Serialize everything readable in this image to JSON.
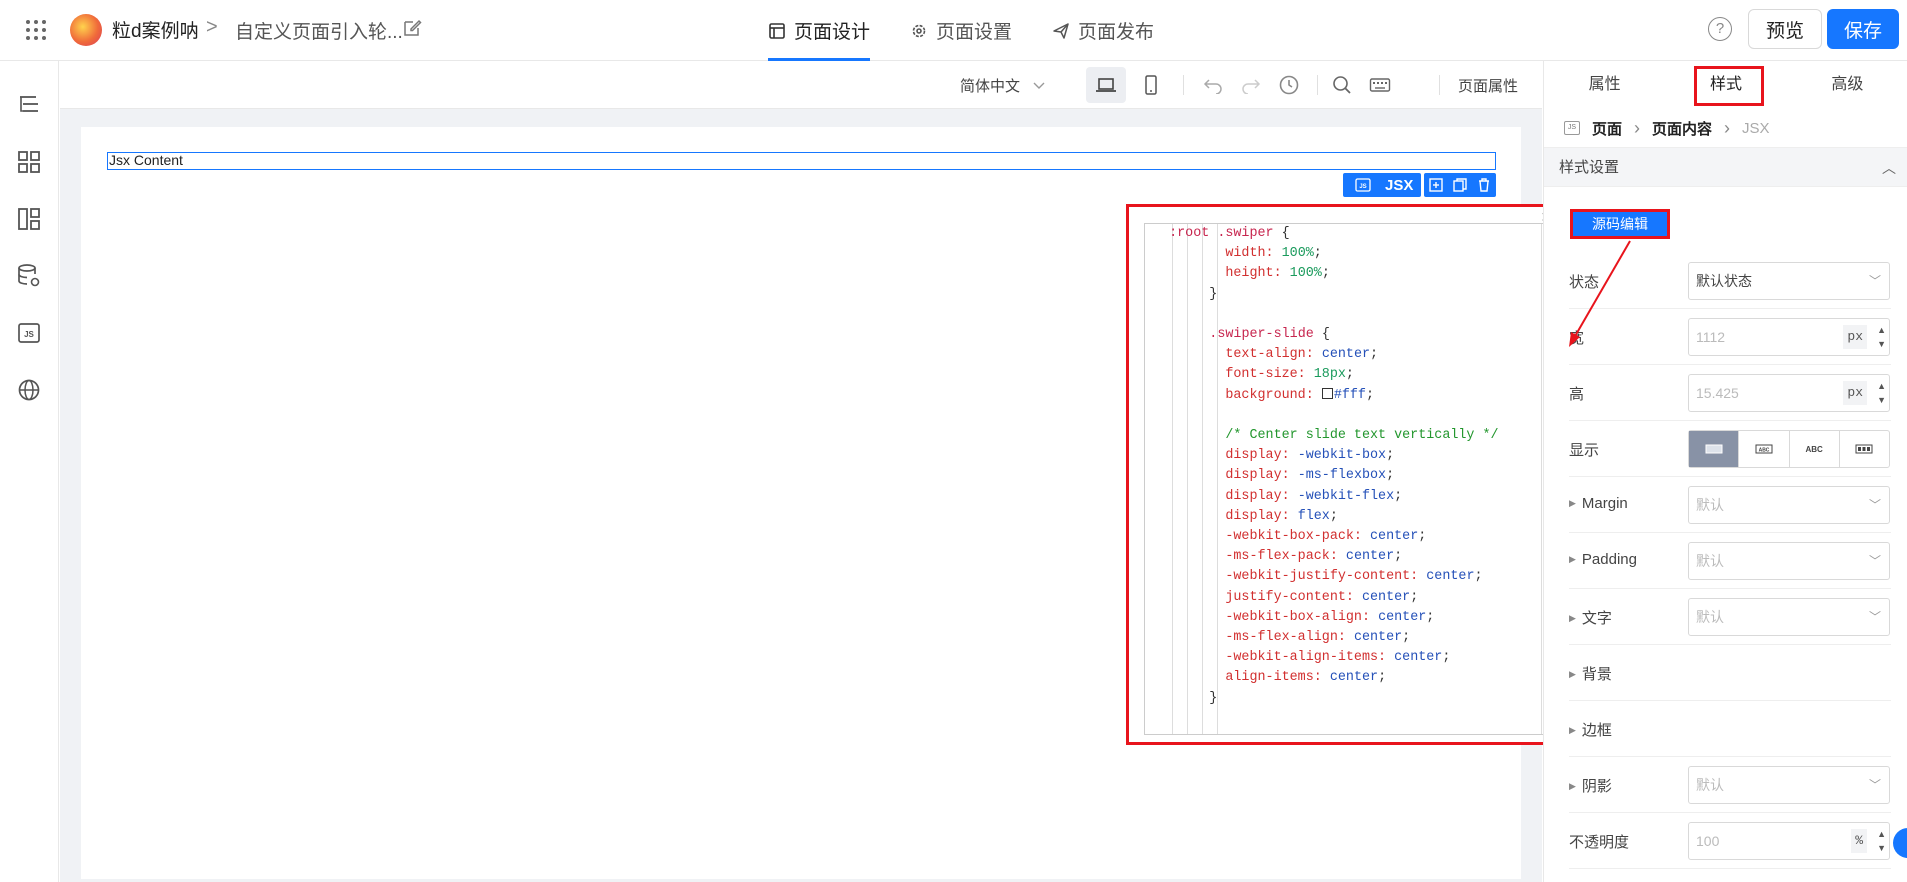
{
  "header": {
    "app_name": "粒d案例呐",
    "breadcrumb_sep": ">",
    "page_name": "自定义页面引入轮...",
    "tabs": [
      {
        "label": "页面设计",
        "icon": "page-design-icon",
        "active": true
      },
      {
        "label": "页面设置",
        "icon": "gear-icon",
        "active": false
      },
      {
        "label": "页面发布",
        "icon": "send-icon",
        "active": false
      }
    ],
    "help_label": "?",
    "preview_label": "预览",
    "save_label": "保存",
    "accent_color": "#1677ff"
  },
  "sidebar": {
    "items": [
      {
        "icon": "outline-tree-icon"
      },
      {
        "icon": "components-grid-icon"
      },
      {
        "icon": "layout-icon"
      },
      {
        "icon": "data-source-icon"
      },
      {
        "icon": "js-code-icon"
      },
      {
        "icon": "globe-icon"
      }
    ]
  },
  "toolbar": {
    "language": "简体中文",
    "page_props": "页面属性",
    "device_active": "desktop"
  },
  "canvas": {
    "component_text": "Jsx Content",
    "component_badge": "JSX",
    "js_badge": "JS"
  },
  "code_editor": {
    "close_label": "×",
    "highlight_color": "#e8141c"
  },
  "right_panel": {
    "tabs": [
      {
        "label": "属性",
        "active": false
      },
      {
        "label": "样式",
        "active": true
      },
      {
        "label": "高级",
        "active": false
      }
    ],
    "breadcrumb": {
      "icon_text": "JS",
      "page": "页面",
      "content": "页面内容",
      "current": "JSX"
    },
    "section_title": "样式设置",
    "source_edit_label": "源码编辑",
    "state": {
      "label": "状态",
      "value": "默认状态"
    },
    "width": {
      "label": "宽",
      "value": "1112",
      "unit": "px"
    },
    "height": {
      "label": "高",
      "value": "15.425",
      "unit": "px"
    },
    "display": {
      "label": "显示",
      "options": [
        "block",
        "ABC",
        "ABC",
        "inline-block"
      ],
      "active_index": 0
    },
    "margin": {
      "label": "Margin",
      "value": "默认"
    },
    "padding": {
      "label": "Padding",
      "value": "默认"
    },
    "text": {
      "label": "文字",
      "value": "默认"
    },
    "background": {
      "label": "背景"
    },
    "border": {
      "label": "边框"
    },
    "shadow": {
      "label": "阴影",
      "value": "默认"
    },
    "opacity": {
      "label": "不透明度",
      "value": "100",
      "unit": "%"
    }
  }
}
